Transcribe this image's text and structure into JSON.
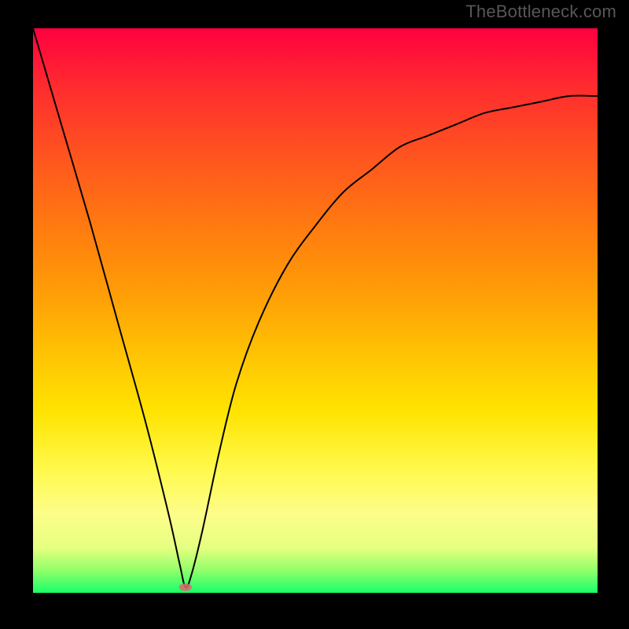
{
  "branding": {
    "text": "TheBottleneck.com"
  },
  "chart_data": {
    "type": "line",
    "title": "",
    "xlabel": "",
    "ylabel": "",
    "xlim": [
      0,
      100
    ],
    "ylim": [
      0,
      100
    ],
    "grid": false,
    "legend": false,
    "series": [
      {
        "name": "bottleneck-curve",
        "x": [
          0,
          5,
          10,
          15,
          20,
          24,
          26,
          27,
          28,
          30,
          33,
          36,
          40,
          45,
          50,
          55,
          60,
          65,
          70,
          75,
          80,
          85,
          90,
          95,
          100
        ],
        "y": [
          100,
          83,
          66,
          48,
          30,
          14,
          5,
          1,
          3,
          11,
          25,
          37,
          48,
          58,
          65,
          71,
          75,
          79,
          81,
          83,
          85,
          86,
          87,
          88,
          88
        ]
      }
    ],
    "annotations": [
      {
        "type": "marker",
        "shape": "ellipse",
        "x": 27,
        "y": 1,
        "label": "bottleneck-minimum"
      }
    ],
    "background_gradient": {
      "direction": "vertical",
      "stops": [
        {
          "pos": 0.0,
          "color": "#ff0040"
        },
        {
          "pos": 0.5,
          "color": "#ffc403"
        },
        {
          "pos": 0.85,
          "color": "#fdfd8a"
        },
        {
          "pos": 1.0,
          "color": "#18ff69"
        }
      ]
    }
  }
}
